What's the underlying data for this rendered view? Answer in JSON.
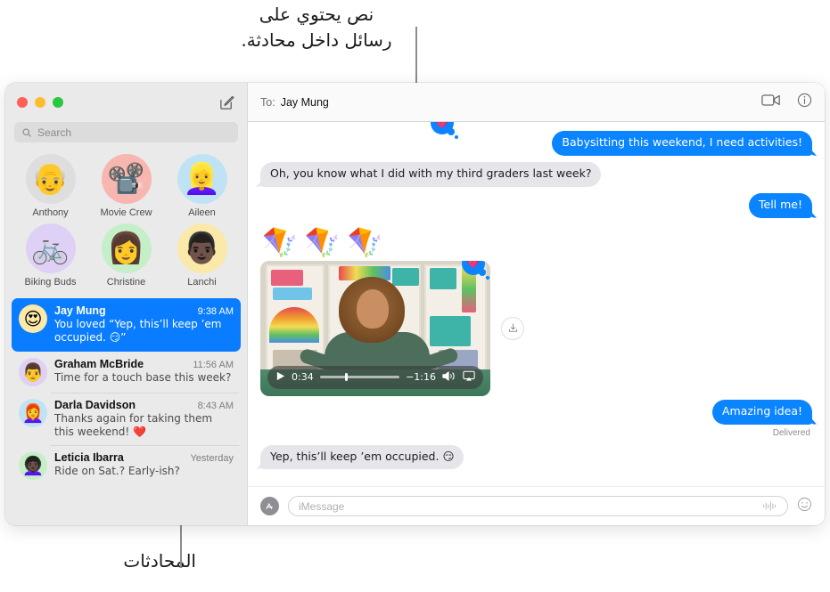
{
  "callouts": {
    "top": "نص يحتوي على\nرسائل داخل محادثة.",
    "bottom": "المحادثات"
  },
  "window": {
    "traffic_lights": [
      "close-red",
      "minimize-yellow",
      "zoom-green"
    ],
    "compose_icon": "compose-icon"
  },
  "sidebar": {
    "search": {
      "placeholder": "Search",
      "icon": "search-icon"
    },
    "pinned": [
      {
        "name": "Anthony",
        "glyph": "👴",
        "bg": "#dedede"
      },
      {
        "name": "Movie Crew",
        "glyph": "📽️",
        "bg": "#f8b6b0"
      },
      {
        "name": "Aileen",
        "glyph": "👱‍♀️",
        "bg": "#bfe3f5"
      },
      {
        "name": "Biking Buds",
        "glyph": "🚲",
        "bg": "#dfd0f5"
      },
      {
        "name": "Christine",
        "glyph": "👩",
        "bg": "#c5efc8"
      },
      {
        "name": "Lanchi",
        "glyph": "👨🏿",
        "bg": "#fae9a8"
      }
    ],
    "conversations": [
      {
        "name": "Jay Mung",
        "time": "9:38 AM",
        "snippet": "You loved “Yep, this’ll keep ’em occupied. 😏”",
        "avatar_glyph": "😍",
        "avatar_bg": "#fae9a8",
        "selected": true
      },
      {
        "name": "Graham McBride",
        "time": "11:56 AM",
        "snippet": "Time for a touch base this week?",
        "avatar_glyph": "👨",
        "avatar_bg": "#dfd0f5",
        "selected": false
      },
      {
        "name": "Darla Davidson",
        "time": "8:43 AM",
        "snippet": "Thanks again for taking them this weekend! ❤️",
        "avatar_glyph": "👩‍🦰",
        "avatar_bg": "#bfe3f5",
        "selected": false
      },
      {
        "name": "Leticia Ibarra",
        "time": "Yesterday",
        "snippet": "Ride on Sat.? Early-ish?",
        "avatar_glyph": "👩🏿‍🦱",
        "avatar_bg": "#c5efc8",
        "selected": false
      }
    ]
  },
  "conversation": {
    "to_label": "To:",
    "to_name": "Jay Mung",
    "facetime_icon": "video-camera-icon",
    "details_icon": "info-circle-icon",
    "messages": [
      {
        "text": "Babysitting this weekend, I need activities!",
        "side": "out"
      },
      {
        "text": "Oh, you know what I did with my third graders last week?",
        "side": "in"
      },
      {
        "text": "Tell me!",
        "side": "out"
      }
    ],
    "kites": "🪁🪁🪁",
    "video": {
      "play_icon": "play-icon",
      "elapsed": "0:34",
      "remaining": "−1:16",
      "volume_icon": "volume-high-icon",
      "airplay_icon": "airplay-icon",
      "save_icon": "download-icon",
      "progress_percent": 32,
      "tapback": "💗"
    },
    "reply": {
      "text": "Amazing idea!",
      "side": "out",
      "status": "Delivered"
    },
    "final_message": {
      "text": "Yep, this’ll keep ’em occupied. 😏",
      "side": "in",
      "tapback": "💗"
    }
  },
  "input_bar": {
    "apps_icon": "app-store-icon",
    "apps_glyph": "",
    "placeholder": "iMessage",
    "mic_icon": "audio-waveform-icon",
    "emoji_icon": "emoji-smiley-icon",
    "emoji_glyph": "☺"
  },
  "colors": {
    "accent_blue": "#0a84ff",
    "selected_row": "#0a7cff",
    "incoming_gray": "#e6e5ea",
    "sidebar_bg": "#eaeaea",
    "tapback_heart": "#ff7ba8"
  }
}
